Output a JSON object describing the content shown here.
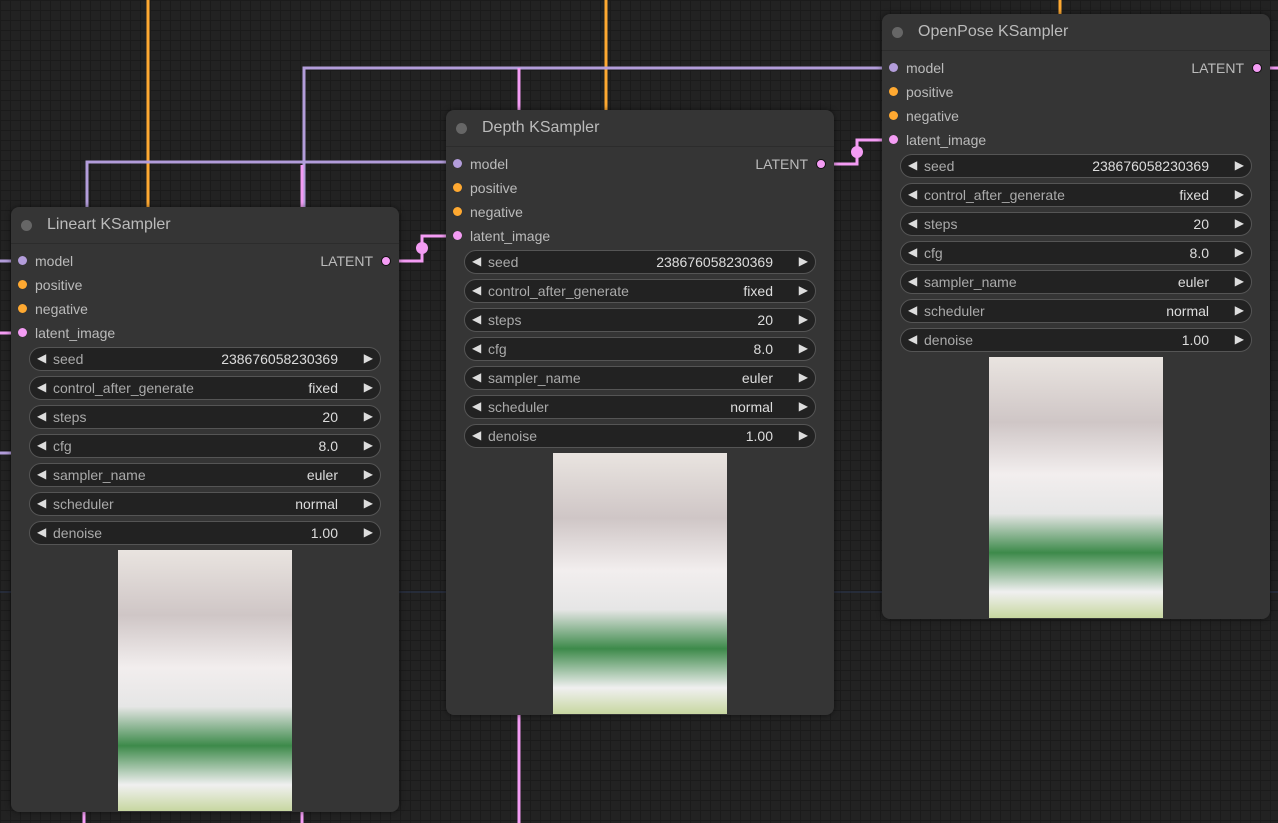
{
  "colors": {
    "model": "#b39ddb",
    "conditioning": "#ffa931",
    "latent": "#f49cf4",
    "background": "#222222",
    "node": "#353535"
  },
  "nodes": [
    {
      "id": "lineart",
      "title": "Lineart KSampler",
      "inputs": [
        {
          "label": "model",
          "type": "model"
        },
        {
          "label": "positive",
          "type": "conditioning"
        },
        {
          "label": "negative",
          "type": "conditioning"
        },
        {
          "label": "latent_image",
          "type": "latent"
        }
      ],
      "output": "LATENT",
      "widgets": [
        {
          "name": "seed",
          "value": "238676058230369"
        },
        {
          "name": "control_after_generate",
          "value": "fixed"
        },
        {
          "name": "steps",
          "value": "20"
        },
        {
          "name": "cfg",
          "value": "8.0"
        },
        {
          "name": "sampler_name",
          "value": "euler"
        },
        {
          "name": "scheduler",
          "value": "normal"
        },
        {
          "name": "denoise",
          "value": "1.00"
        }
      ]
    },
    {
      "id": "depth",
      "title": "Depth KSampler",
      "inputs": [
        {
          "label": "model",
          "type": "model"
        },
        {
          "label": "positive",
          "type": "conditioning"
        },
        {
          "label": "negative",
          "type": "conditioning"
        },
        {
          "label": "latent_image",
          "type": "latent"
        }
      ],
      "output": "LATENT",
      "widgets": [
        {
          "name": "seed",
          "value": "238676058230369"
        },
        {
          "name": "control_after_generate",
          "value": "fixed"
        },
        {
          "name": "steps",
          "value": "20"
        },
        {
          "name": "cfg",
          "value": "8.0"
        },
        {
          "name": "sampler_name",
          "value": "euler"
        },
        {
          "name": "scheduler",
          "value": "normal"
        },
        {
          "name": "denoise",
          "value": "1.00"
        }
      ]
    },
    {
      "id": "openpose",
      "title": "OpenPose KSampler",
      "inputs": [
        {
          "label": "model",
          "type": "model"
        },
        {
          "label": "positive",
          "type": "conditioning"
        },
        {
          "label": "negative",
          "type": "conditioning"
        },
        {
          "label": "latent_image",
          "type": "latent"
        }
      ],
      "output": "LATENT",
      "widgets": [
        {
          "name": "seed",
          "value": "238676058230369"
        },
        {
          "name": "control_after_generate",
          "value": "fixed"
        },
        {
          "name": "steps",
          "value": "20"
        },
        {
          "name": "cfg",
          "value": "8.0"
        },
        {
          "name": "sampler_name",
          "value": "euler"
        },
        {
          "name": "scheduler",
          "value": "normal"
        },
        {
          "name": "denoise",
          "value": "1.00"
        }
      ]
    }
  ]
}
